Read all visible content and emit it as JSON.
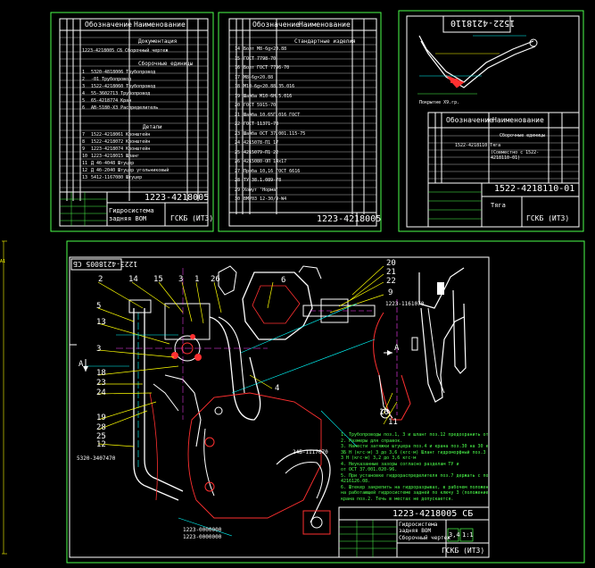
{
  "colors": {
    "background": "#000000",
    "frame": "#00ff00",
    "outline": "#ffffff",
    "dimension": "#00ffff",
    "accent": "#ffff00",
    "hatch": "#ff3030",
    "center": "#ff40ff"
  },
  "sheet1": {
    "header_left": "Обозначение",
    "header_right": "Наименование",
    "section_docs": "Документация",
    "doc_item": "1223-4218005 СБ Сборочный чертеж",
    "section_units": "Сборочные единицы",
    "unit_rows": [
      {
        "pos": "1",
        "name": "5320-4818006 Трубопровод"
      },
      {
        "pos": "2",
        "name": "-01 Трубопровод"
      },
      {
        "pos": "3",
        "name": "1522-4218060 Трубопровод"
      },
      {
        "pos": "4",
        "name": "55-3602713 Трубопровод"
      },
      {
        "pos": "5",
        "name": "65-4218774 Кран"
      },
      {
        "pos": "6",
        "name": "АВ-5180-ХЗ Распределитель"
      }
    ],
    "section_parts": "Детали",
    "part_rows": [
      {
        "pos": "7",
        "name": "1522-4218061 Кронштейн"
      },
      {
        "pos": "8",
        "name": "1522-4218072 Кронштейн"
      },
      {
        "pos": "9",
        "name": "1223-4218074 Кронштейн"
      },
      {
        "pos": "10",
        "name": "1223-4218015 Шланг"
      },
      {
        "pos": "11",
        "name": "Д 4б-4048 Штуцер"
      },
      {
        "pos": "12",
        "name": "Д 4б-2040 Штуцер угольниковый"
      },
      {
        "pos": "13",
        "name": "5412-1167080 Штуцер"
      }
    ],
    "title_code": "1223-4218005",
    "title_name": "Гидросистема задняя ВОМ",
    "company": "ГСКБ (ИТЗ)"
  },
  "sheet2": {
    "header_left": "Обозначение",
    "header_right": "Наименование",
    "section": "Стандартные изделия",
    "rows": [
      {
        "pos": "14",
        "name": "Болт М8-6g×20.88"
      },
      {
        "pos": "15",
        "name": "ГОСТ 7798-70"
      },
      {
        "pos": "16",
        "name": "Болт ГОСТ 7796-70"
      },
      {
        "pos": "17",
        "name": "М8-6g×20.88"
      },
      {
        "pos": "18",
        "name": "М10-6g×20.88.35.016"
      },
      {
        "pos": "19",
        "name": "Шайба М10-6Н.5.016"
      },
      {
        "pos": "20",
        "name": "ГОСТ 5915-70"
      },
      {
        "pos": "21",
        "name": "Шайба 10.65Г.016 ГОСТ"
      },
      {
        "pos": "22",
        "name": "ГОСТ 11371-78"
      },
      {
        "pos": "23",
        "name": "Шайба ОСТ 37.001.115-75"
      },
      {
        "pos": "24",
        "name": "4215078-П1 17"
      },
      {
        "pos": "25",
        "name": "4215079-П1 22"
      },
      {
        "pos": "26",
        "name": "4215080-ОП 14х17"
      },
      {
        "pos": "27",
        "name": "Проба 10,16 ГОСТ 6616"
      },
      {
        "pos": "28",
        "name": "ТУ 38.1.089-78"
      },
      {
        "pos": "29",
        "name": "Хомут 'Норма'"
      },
      {
        "pos": "30",
        "name": "ВМУ03 12-30/9-W4"
      }
    ],
    "title_code": "1223-4218005"
  },
  "sheet3": {
    "vertical_code": "1522-4218110",
    "note": "Покрытие Х9.гр.",
    "header_left": "Обозначение",
    "header_right": "Наименование",
    "section": "Сборочные единицы",
    "item": "1522-4218110 Тяга",
    "item_note": "(Совместно с 1522-4218110-01)",
    "title_code": "1522-4218110-01",
    "title_name": "Тяга",
    "company": "ГСКБ (ИТЗ)"
  },
  "main": {
    "side_code": "1223-4218005 СБ",
    "ref_top": "1223-1161070",
    "ref_left": "5320-3407470",
    "ref_bottom1": "1223-0000000",
    "ref_bottom2": "1223-0000000",
    "ref_mid": "24Б-1117070",
    "view_marker": "А",
    "callouts_left": [
      "2",
      "14",
      "15",
      "3",
      "1",
      "26",
      "5",
      "13",
      "3",
      "18",
      "23",
      "24",
      "19",
      "28",
      "25",
      "12",
      "12"
    ],
    "callouts_top": [
      "6",
      "4",
      "20",
      "21",
      "22",
      "9"
    ],
    "callouts_right": [
      "10",
      "11",
      "А"
    ],
    "notes": [
      "1. Трубопроводы поз.1, 3 и шланг поз.12 предохранить от механических повреждений.",
      "2. Размеры для справок.",
      "3. Нанести затяжки штуцера поз.4 и крана поз.30 на 30 кгс·м",
      "3Б Н (кгс·м) 3 до 3,6 (кгс·м) Шланг гидроморфный поз.3 до",
      "3 Н (кгс·м) 3,2 до 3,6 кгс·м",
      "4. Неуказанные зазоры согласно разделам ТУ и",
      "от ОСТ 37.001.020-96.",
      "5. При установке гидрораспределителя поз.7 держать с помощью",
      "4216126.08.",
      "6. Штекер закрепить на гидроразрывах, в рабочем положении",
      "на работающей гидросистеме задней по ключу 3 (положение",
      "крана поз.2. Течь в местах не допускается."
    ],
    "title_code": "1223-4218005 СБ",
    "title_name": "Гидросистема задняя ВОМ",
    "subtitle": "Сборочный чертеж",
    "scale": "1:1",
    "mass": "3,4",
    "company": "ГСКБ (ИТЗ)"
  },
  "ruler_label": "А1"
}
